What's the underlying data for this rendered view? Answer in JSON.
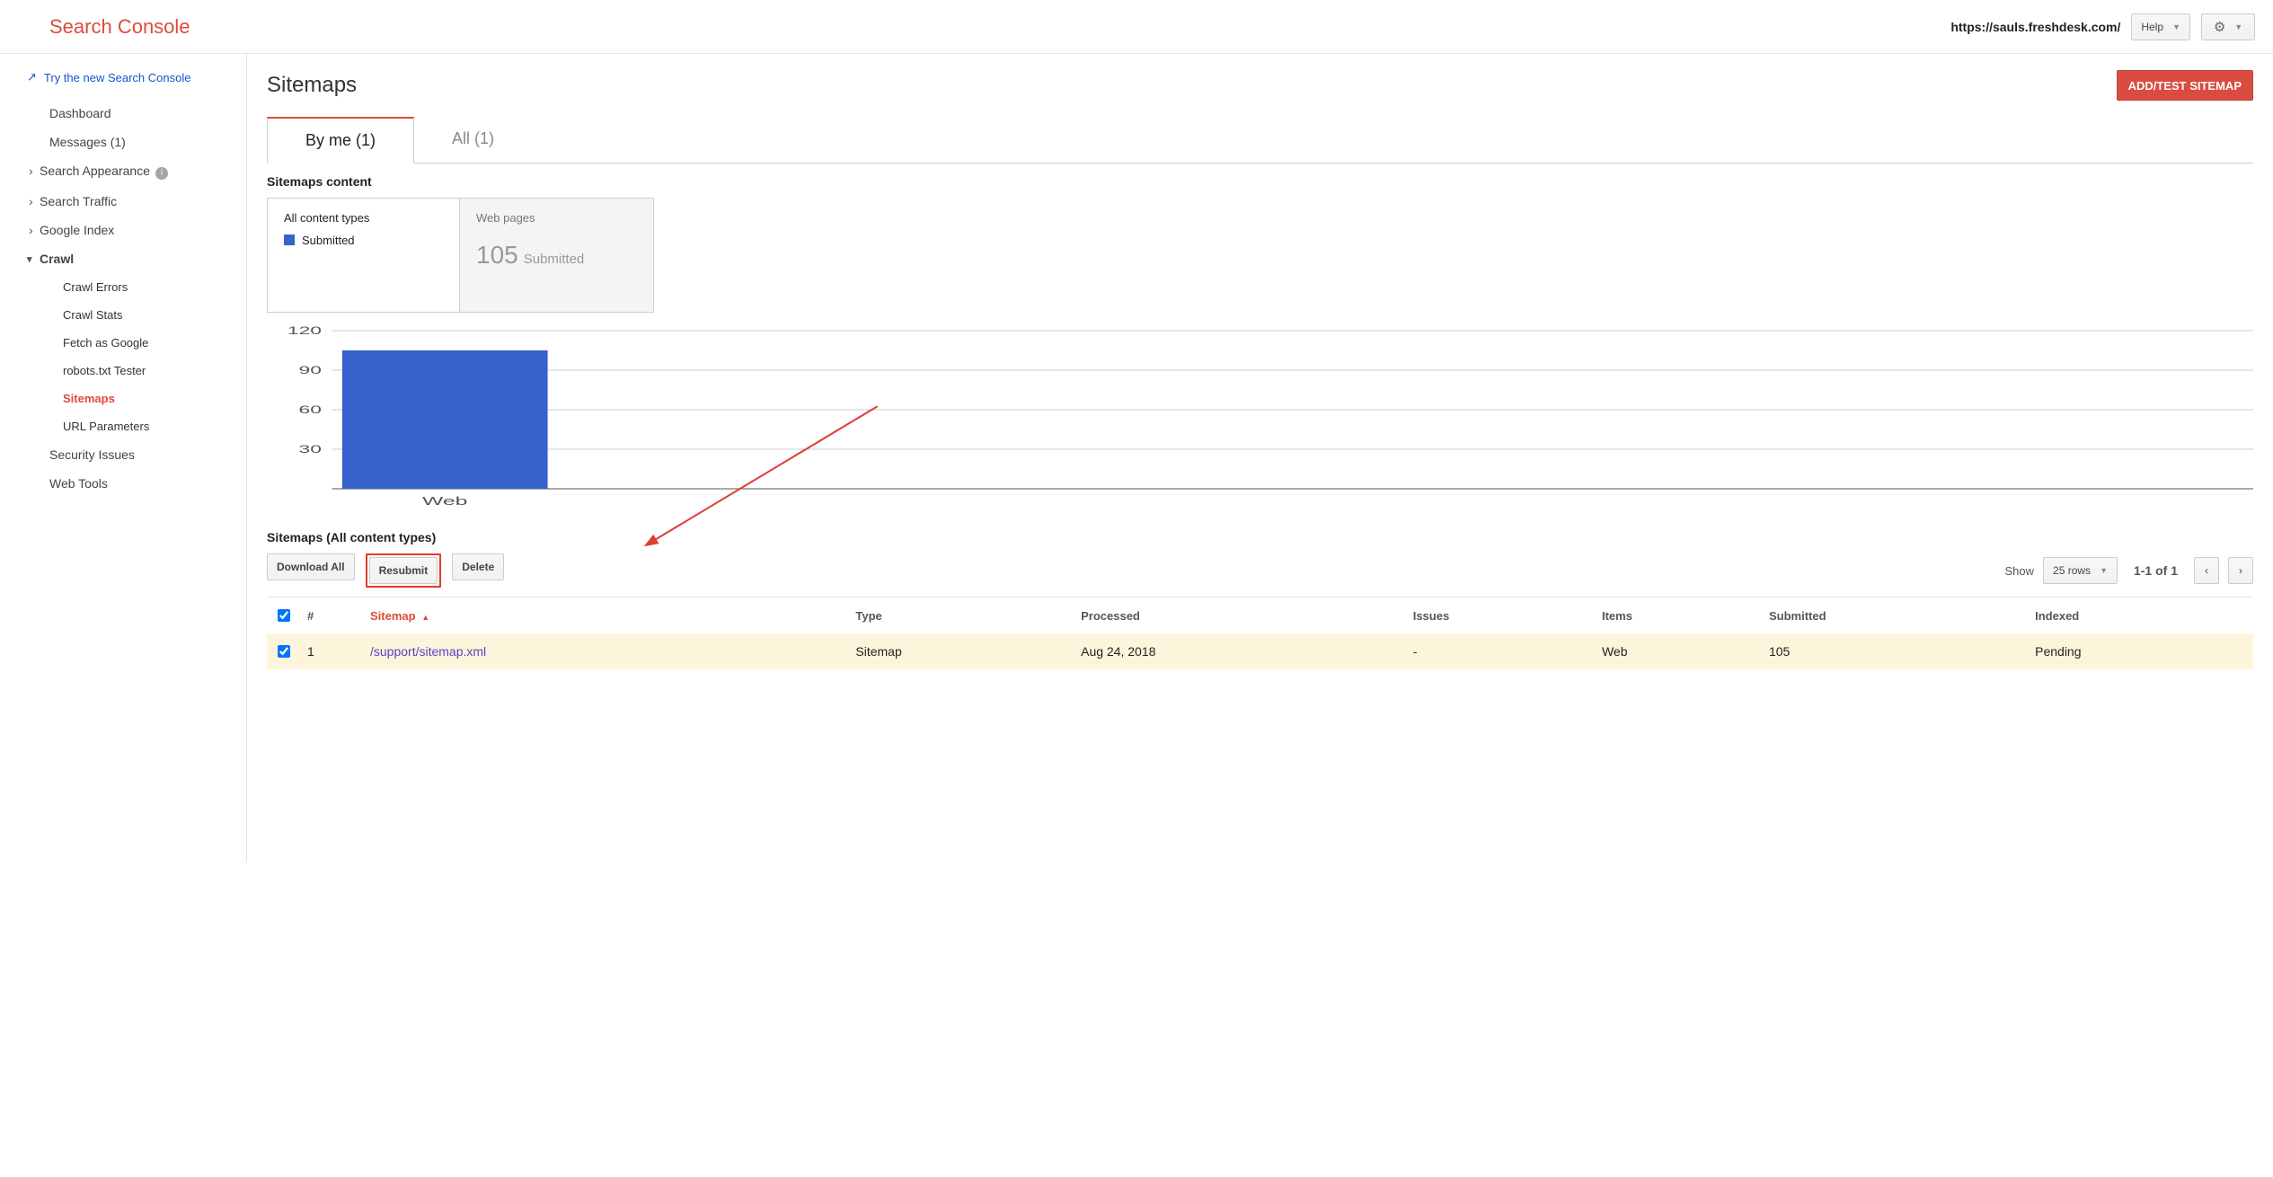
{
  "header": {
    "logo": "Search Console",
    "site_url": "https://sauls.freshdesk.com/",
    "help_label": "Help"
  },
  "sidebar": {
    "try_link": "Try the new Search Console",
    "items": [
      {
        "label": "Dashboard",
        "kind": "item"
      },
      {
        "label": "Messages (1)",
        "kind": "item"
      },
      {
        "label": "Search Appearance",
        "kind": "group",
        "info": true
      },
      {
        "label": "Search Traffic",
        "kind": "group"
      },
      {
        "label": "Google Index",
        "kind": "group"
      },
      {
        "label": "Crawl",
        "kind": "group",
        "expanded": true
      },
      {
        "label": "Crawl Errors",
        "kind": "child"
      },
      {
        "label": "Crawl Stats",
        "kind": "child"
      },
      {
        "label": "Fetch as Google",
        "kind": "child"
      },
      {
        "label": "robots.txt Tester",
        "kind": "child"
      },
      {
        "label": "Sitemaps",
        "kind": "child",
        "active": true
      },
      {
        "label": "URL Parameters",
        "kind": "child"
      },
      {
        "label": "Security Issues",
        "kind": "item"
      },
      {
        "label": "Web Tools",
        "kind": "item"
      }
    ]
  },
  "main": {
    "title": "Sitemaps",
    "add_btn": "ADD/TEST SITEMAP",
    "tabs": [
      {
        "label": "By me (1)",
        "active": true
      },
      {
        "label": "All (1)",
        "active": false
      }
    ],
    "content_title": "Sitemaps content",
    "card_all": {
      "title": "All content types",
      "legend": "Submitted"
    },
    "card_web": {
      "title": "Web pages",
      "value": "105",
      "tag": "Submitted"
    },
    "list_title": "Sitemaps (All content types)",
    "buttons": {
      "download": "Download All",
      "resubmit": "Resubmit",
      "delete": "Delete"
    },
    "show_label": "Show",
    "rows_sel": "25 rows",
    "range": "1-1 of 1",
    "table": {
      "headers": [
        "#",
        "Sitemap",
        "Type",
        "Processed",
        "Issues",
        "Items",
        "Submitted",
        "Indexed"
      ],
      "rows": [
        {
          "n": "1",
          "sitemap": "/support/sitemap.xml",
          "type": "Sitemap",
          "processed": "Aug 24, 2018",
          "issues": "-",
          "items": "Web",
          "submitted": "105",
          "indexed": "Pending"
        }
      ]
    }
  },
  "chart_data": {
    "type": "bar",
    "categories": [
      "Web"
    ],
    "values": [
      105
    ],
    "ylabel": "",
    "ylim": [
      0,
      120
    ],
    "yticks": [
      30,
      60,
      90,
      120
    ],
    "series": [
      {
        "name": "Submitted",
        "values": [
          105
        ],
        "color": "#3761cc"
      }
    ]
  }
}
